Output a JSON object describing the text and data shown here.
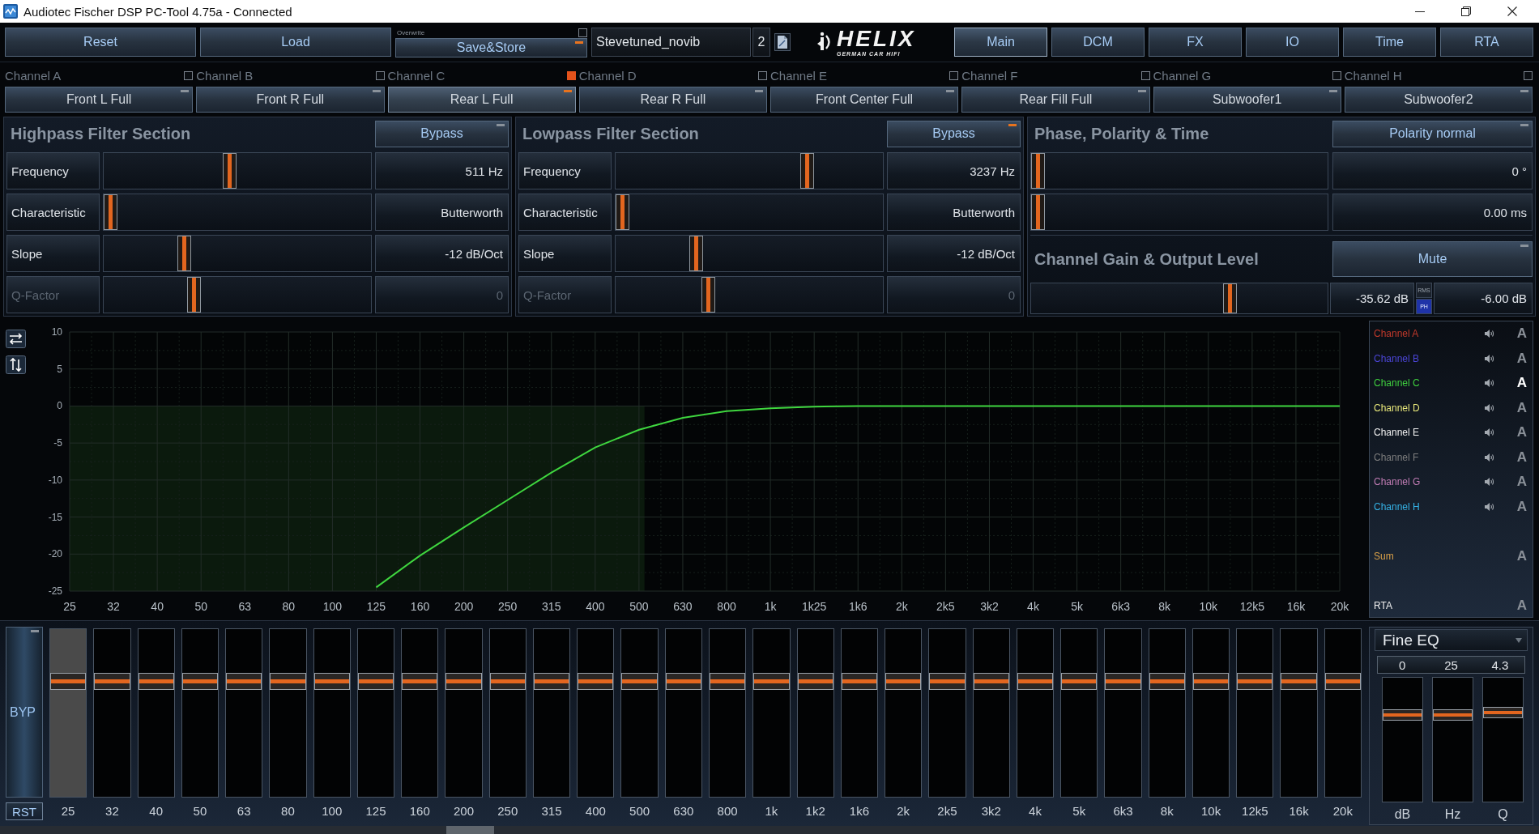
{
  "window": {
    "title": "Audiotec Fischer DSP PC-Tool 4.75a - Connected"
  },
  "toolbar": {
    "buttons": [
      {
        "label": "Reset"
      },
      {
        "label": "Load"
      }
    ],
    "save": {
      "overwrite_label": "Overwrite",
      "overwrite_checked": false,
      "label": "Save&Store",
      "on": true
    },
    "preset_name": "Stevetuned_novib",
    "preset_number": "2",
    "logo": {
      "name": "HELIX",
      "tagline": "GERMAN CAR HIFI"
    }
  },
  "tabs": [
    {
      "label": "Main",
      "selected": true
    },
    {
      "label": "DCM",
      "selected": false
    },
    {
      "label": "FX",
      "selected": false
    },
    {
      "label": "IO",
      "selected": false
    },
    {
      "label": "Time",
      "selected": false
    },
    {
      "label": "RTA",
      "selected": false
    }
  ],
  "channels": [
    {
      "name": "Channel A",
      "checked": false,
      "preset": "Front L Full",
      "selected": false
    },
    {
      "name": "Channel B",
      "checked": false,
      "preset": "Front R Full",
      "selected": false
    },
    {
      "name": "Channel C",
      "checked": true,
      "preset": "Rear L Full",
      "selected": true
    },
    {
      "name": "Channel D",
      "checked": false,
      "preset": "Rear R Full",
      "selected": false
    },
    {
      "name": "Channel E",
      "checked": false,
      "preset": "Front Center Full",
      "selected": false
    },
    {
      "name": "Channel F",
      "checked": false,
      "preset": "Rear Fill Full",
      "selected": false
    },
    {
      "name": "Channel G",
      "checked": false,
      "preset": "Subwoofer1",
      "selected": false
    },
    {
      "name": "Channel H",
      "checked": false,
      "preset": "Subwoofer2",
      "selected": false
    }
  ],
  "highpass": {
    "title": "Highpass Filter Section",
    "bypass": {
      "label": "Bypass",
      "on": false
    },
    "rows": [
      {
        "label": "Frequency",
        "level": 0.47,
        "value": "511 Hz",
        "disabled": false
      },
      {
        "label": "Characteristic",
        "level": 0,
        "value": "Butterworth",
        "disabled": false
      },
      {
        "label": "Slope",
        "level": 0.29,
        "value": "-12 dB/Oct",
        "disabled": false
      },
      {
        "label": "Q-Factor",
        "level": 0.33,
        "value": "0",
        "disabled": true
      }
    ]
  },
  "lowpass": {
    "title": "Lowpass Filter Section",
    "bypass": {
      "label": "Bypass",
      "on": true
    },
    "rows": [
      {
        "label": "Frequency",
        "level": 0.73,
        "value": "3237 Hz",
        "disabled": false
      },
      {
        "label": "Characteristic",
        "level": 0,
        "value": "Butterworth",
        "disabled": false
      },
      {
        "label": "Slope",
        "level": 0.29,
        "value": "-12 dB/Oct",
        "disabled": false
      },
      {
        "label": "Q-Factor",
        "level": 0.34,
        "value": "0",
        "disabled": true
      }
    ]
  },
  "phase": {
    "title": "Phase, Polarity & Time",
    "polarity": {
      "label": "Polarity normal",
      "on": false
    },
    "rows": [
      {
        "level": 0,
        "value": "0 °"
      },
      {
        "level": 0,
        "value": "0.00 ms"
      }
    ]
  },
  "gain": {
    "title": "Channel Gain & Output Level",
    "mute": {
      "label": "Mute",
      "on": false
    },
    "level": 0.68,
    "reading": "-35.62 dB",
    "meter_modes": [
      {
        "label": "RMS",
        "selected": false
      },
      {
        "label": "PH",
        "selected": true
      }
    ],
    "output": "-6.00 dB"
  },
  "graph": {
    "chart_data": {
      "type": "line",
      "categories": [
        "25",
        "32",
        "40",
        "50",
        "63",
        "80",
        "100",
        "125",
        "160",
        "200",
        "250",
        "315",
        "400",
        "500",
        "630",
        "800",
        "1k",
        "1k25",
        "1k6",
        "2k",
        "2k5",
        "3k2",
        "4k",
        "5k",
        "6k3",
        "8k",
        "10k",
        "12k5",
        "16k",
        "20k"
      ],
      "series": [
        {
          "color": "#3fd63f",
          "values": [
            null,
            null,
            null,
            null,
            null,
            null,
            null,
            -24.5,
            -20.2,
            -16.4,
            -12.7,
            -9,
            -5.6,
            -3.2,
            -1.6,
            -0.7,
            -0.3,
            -0.1,
            0,
            0,
            0,
            0,
            0,
            0,
            0,
            0,
            0,
            0,
            0,
            0
          ]
        }
      ],
      "ylim": [
        -25,
        10
      ],
      "yticks": [
        10,
        5,
        0,
        -5,
        -10,
        -15,
        -20,
        -25
      ],
      "grid": true
    }
  },
  "legend": [
    {
      "label": "Channel A",
      "color": "#c0392b",
      "kind": "channel",
      "button": "A",
      "selected": false
    },
    {
      "label": "Channel B",
      "color": "#4b45d6",
      "kind": "channel",
      "button": "A",
      "selected": false
    },
    {
      "label": "Channel C",
      "color": "#3fcf3f",
      "kind": "channel",
      "button": "A",
      "selected": true
    },
    {
      "label": "Channel D",
      "color": "#e6e67a",
      "kind": "channel",
      "button": "A",
      "selected": false
    },
    {
      "label": "Channel E",
      "color": "#f0f0f0",
      "kind": "channel",
      "button": "A",
      "selected": false
    },
    {
      "label": "Channel F",
      "color": "#7d7d7d",
      "kind": "channel",
      "button": "A",
      "selected": false
    },
    {
      "label": "Channel G",
      "color": "#c07cb4",
      "kind": "channel",
      "button": "A",
      "selected": false
    },
    {
      "label": "Channel H",
      "color": "#35b2e6",
      "kind": "channel",
      "button": "A",
      "selected": false
    },
    {
      "label": "Sum",
      "color": "#d9a048",
      "kind": "analysis",
      "button": "A",
      "selected": false
    },
    {
      "label": "RTA",
      "color": "#f0f0f0",
      "kind": "analysis",
      "button": "A",
      "selected": false
    }
  ],
  "eq": {
    "bypass": {
      "label": "BYP",
      "on": false
    },
    "reset": "RST",
    "bands": [
      {
        "label": "25",
        "level": 0.71,
        "selected": true
      },
      {
        "label": "32",
        "level": 0.71,
        "selected": false
      },
      {
        "label": "40",
        "level": 0.71,
        "selected": false
      },
      {
        "label": "50",
        "level": 0.71,
        "selected": false
      },
      {
        "label": "63",
        "level": 0.71,
        "selected": false
      },
      {
        "label": "80",
        "level": 0.71,
        "selected": false
      },
      {
        "label": "100",
        "level": 0.71,
        "selected": false
      },
      {
        "label": "125",
        "level": 0.71,
        "selected": false
      },
      {
        "label": "160",
        "level": 0.71,
        "selected": false
      },
      {
        "label": "200",
        "level": 0.71,
        "selected": false
      },
      {
        "label": "250",
        "level": 0.71,
        "selected": false
      },
      {
        "label": "315",
        "level": 0.71,
        "selected": false
      },
      {
        "label": "400",
        "level": 0.71,
        "selected": false
      },
      {
        "label": "500",
        "level": 0.71,
        "selected": false
      },
      {
        "label": "630",
        "level": 0.71,
        "selected": false
      },
      {
        "label": "800",
        "level": 0.71,
        "selected": false
      },
      {
        "label": "1k",
        "level": 0.71,
        "selected": false
      },
      {
        "label": "1k2",
        "level": 0.71,
        "selected": false
      },
      {
        "label": "1k6",
        "level": 0.71,
        "selected": false
      },
      {
        "label": "2k",
        "level": 0.71,
        "selected": false
      },
      {
        "label": "2k5",
        "level": 0.71,
        "selected": false
      },
      {
        "label": "3k2",
        "level": 0.71,
        "selected": false
      },
      {
        "label": "4k",
        "level": 0.71,
        "selected": false
      },
      {
        "label": "5k",
        "level": 0.71,
        "selected": false
      },
      {
        "label": "6k3",
        "level": 0.71,
        "selected": false
      },
      {
        "label": "8k",
        "level": 0.71,
        "selected": false
      },
      {
        "label": "10k",
        "level": 0.71,
        "selected": false
      },
      {
        "label": "12k5",
        "level": 0.71,
        "selected": false
      },
      {
        "label": "16k",
        "level": 0.71,
        "selected": false
      },
      {
        "label": "20k",
        "level": 0.71,
        "selected": false
      }
    ]
  },
  "fine_eq": {
    "mode": "Fine EQ",
    "params": [
      {
        "value": "0",
        "label": "dB",
        "level": 0.72
      },
      {
        "value": "25",
        "label": "Hz",
        "level": 0.72
      },
      {
        "value": "4.3",
        "label": "Q",
        "level": 0.74
      }
    ]
  }
}
